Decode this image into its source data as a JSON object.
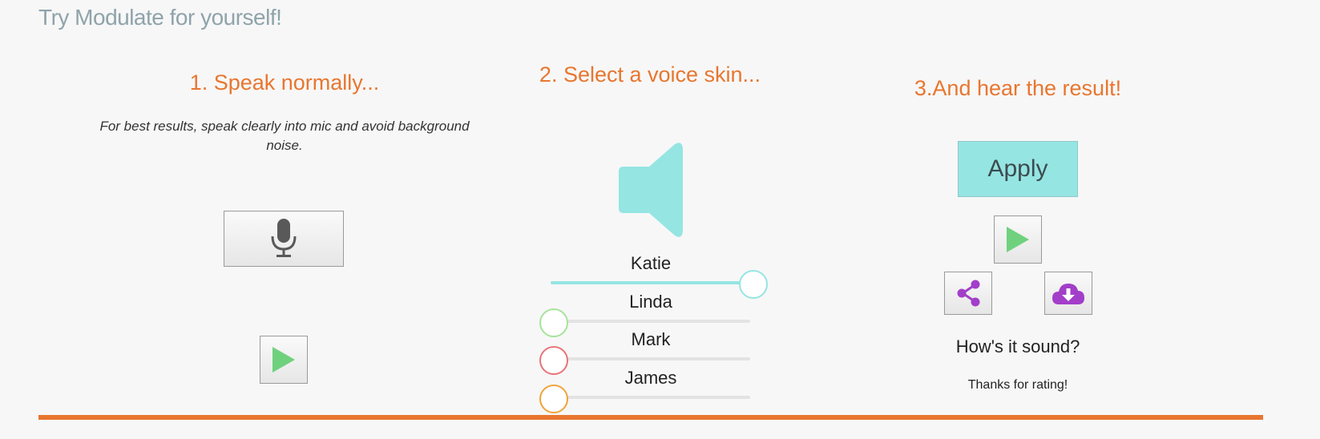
{
  "page_title": "Try Modulate for yourself!",
  "steps": {
    "speak": {
      "heading": "1. Speak normally...",
      "hint": "For best results, speak clearly into mic and avoid background noise."
    },
    "select": {
      "heading": "2. Select a voice skin..."
    },
    "hear": {
      "heading": "3.And hear the result!",
      "apply_label": "Apply",
      "question": "How's it sound?",
      "thanks": "Thanks for rating!"
    }
  },
  "voices": [
    {
      "name": "Katie",
      "level": 1.0,
      "color": "#95e5e3"
    },
    {
      "name": "Linda",
      "level": 0.0,
      "color": "#a6e39a"
    },
    {
      "name": "Mark",
      "level": 0.0,
      "color": "#e87478"
    },
    {
      "name": "James",
      "level": 0.0,
      "color": "#f0a43a"
    }
  ],
  "colors": {
    "accent": "#e8762f",
    "teal": "#95e5e3",
    "play_green": "#6fd17d",
    "purple": "#a23ec9"
  },
  "icons": {
    "record": "microphone-icon",
    "play": "play-icon",
    "volume": "speaker-icon",
    "share": "share-icon",
    "download": "cloud-download-icon"
  }
}
